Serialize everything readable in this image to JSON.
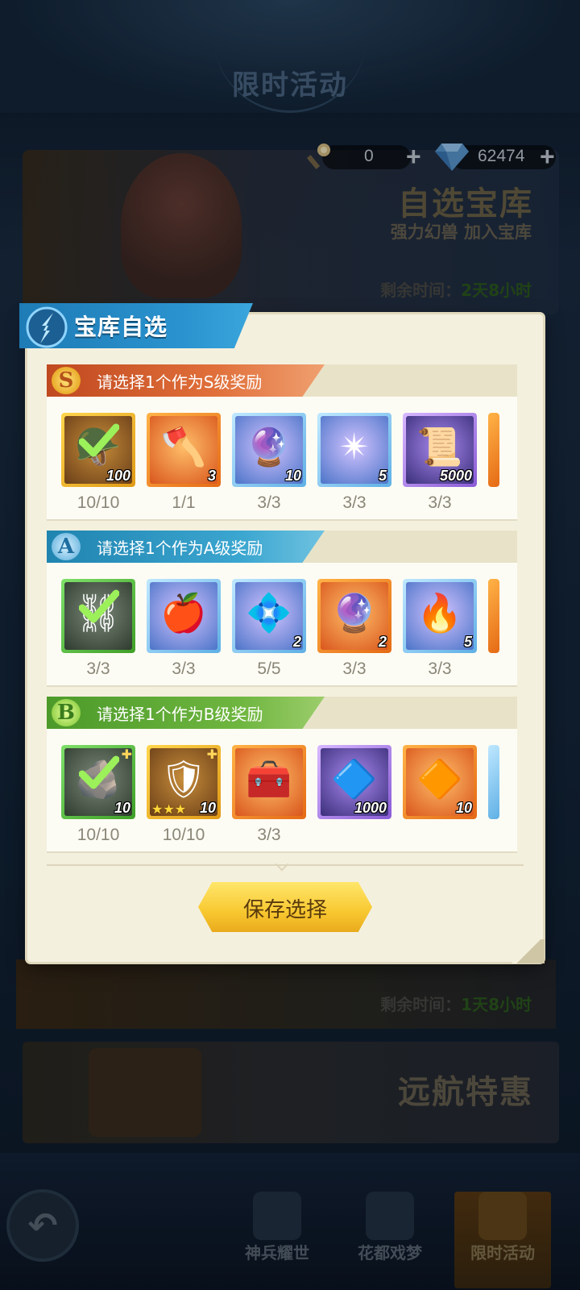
{
  "top": {
    "title": "限时活动"
  },
  "currency": [
    {
      "icon": "torch-icon",
      "value": "0"
    },
    {
      "icon": "diamond-icon",
      "value": "62474"
    }
  ],
  "bg_card_1": {
    "title": "自选宝库",
    "subtitle": "强力幻兽 加入宝库",
    "time_label": "剩余时间：",
    "time_value": "2天8小时"
  },
  "bg_card_2": {
    "time_label": "剩余时间：",
    "time_value": "1天8小时"
  },
  "bg_card_3": {
    "title": "远航特惠"
  },
  "bottom_nav": [
    {
      "label": "神兵耀世"
    },
    {
      "label": "花都戏梦"
    },
    {
      "label": "限时活动",
      "active": true
    }
  ],
  "modal": {
    "title": "宝库自选",
    "save_label": "保存选择",
    "sections": [
      {
        "grade": "S",
        "title": "请选择1个作为S级奖励",
        "items": [
          {
            "name": "golden-chest-item",
            "qty": "100",
            "count": "10/10",
            "rarity": "gold",
            "selected": true,
            "glyph": "🪖"
          },
          {
            "name": "ice-axe-item",
            "qty": "3",
            "count": "1/1",
            "rarity": "orange",
            "selected": false,
            "glyph": "🪓"
          },
          {
            "name": "rune-orb-item",
            "qty": "10",
            "count": "3/3",
            "rarity": "blue",
            "selected": false,
            "glyph": "🔮"
          },
          {
            "name": "dark-star-item",
            "qty": "5",
            "count": "3/3",
            "rarity": "blue",
            "selected": false,
            "glyph": "✴"
          },
          {
            "name": "scroll-item",
            "qty": "5000",
            "count": "3/3",
            "rarity": "purple",
            "selected": false,
            "glyph": "📜"
          }
        ]
      },
      {
        "grade": "A",
        "title": "请选择1个作为A级奖励",
        "items": [
          {
            "name": "chain-whip-item",
            "qty": "",
            "count": "3/3",
            "rarity": "green",
            "selected": true,
            "glyph": "⛓"
          },
          {
            "name": "fruit-item",
            "qty": "",
            "count": "3/3",
            "rarity": "blue",
            "selected": false,
            "glyph": "🍎"
          },
          {
            "name": "crystal-emblem-item",
            "qty": "2",
            "count": "5/5",
            "rarity": "blue",
            "selected": false,
            "glyph": "💠"
          },
          {
            "name": "magic-orb-item",
            "qty": "2",
            "count": "3/3",
            "rarity": "orange",
            "selected": false,
            "glyph": "🔮"
          },
          {
            "name": "flame-item",
            "qty": "5",
            "count": "3/3",
            "rarity": "blue",
            "selected": false,
            "glyph": "🔥"
          }
        ]
      },
      {
        "grade": "B",
        "title": "请选择1个作为B级奖励",
        "items": [
          {
            "name": "ore-item",
            "qty": "10",
            "count": "10/10",
            "rarity": "green",
            "selected": true,
            "glyph": "🪨",
            "corner_plus": true
          },
          {
            "name": "red-armor-item",
            "qty": "10",
            "count": "10/10",
            "rarity": "gold",
            "selected": false,
            "glyph": "🛡",
            "stars": "★★★",
            "corner_plus": true
          },
          {
            "name": "treasure-box-item",
            "qty": "",
            "count": "3/3",
            "rarity": "orange",
            "selected": false,
            "glyph": "🧰"
          },
          {
            "name": "crystal-pile-item",
            "qty": "1000",
            "count": "",
            "rarity": "purple",
            "selected": false,
            "glyph": "🔷"
          },
          {
            "name": "red-gem-item",
            "qty": "10",
            "count": "",
            "rarity": "orange",
            "selected": false,
            "glyph": "🔶"
          }
        ]
      }
    ]
  },
  "colors": {
    "time_green": "#2d5c1f",
    "modal_bg": "#f4f0de",
    "save_button": "#f8c830"
  }
}
